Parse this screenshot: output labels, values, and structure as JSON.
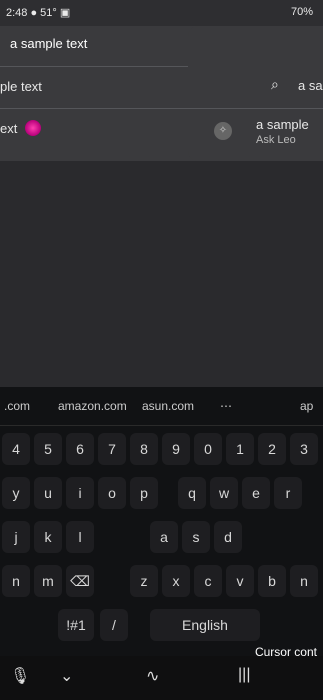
{
  "status": {
    "time": "2:48",
    "icons_left": "● 51° ▣",
    "battery": "70%"
  },
  "search": {
    "value": "a sample text",
    "clear_icon": "✕"
  },
  "results_left": [
    {
      "label": "ple text"
    },
    {
      "label": "ext"
    }
  ],
  "results_right": [
    {
      "icon": "search-icon",
      "label": "a sa"
    },
    {
      "icon": "assistant-icon",
      "label": "a sample",
      "sub": "Ask Leo"
    }
  ],
  "keyboard": {
    "suggestions": [
      ".com",
      "amazon.com",
      "asun.com",
      "⋯",
      "ap"
    ],
    "numbers": [
      "4",
      "5",
      "6",
      "7",
      "8",
      "9",
      "0",
      "1",
      "2",
      "3"
    ],
    "row1": [
      "y",
      "u",
      "i",
      "o",
      "p",
      "q",
      "w",
      "e",
      "r"
    ],
    "row2": [
      "j",
      "k",
      "l",
      "a",
      "s",
      "d"
    ],
    "row3": [
      "n",
      "m",
      "⌫",
      "z",
      "x",
      "c",
      "v",
      "b",
      "n"
    ],
    "row4": [
      "!#1",
      "/",
      "English"
    ],
    "cursor_label": "Cursor cont"
  },
  "colors": {
    "accent": "#ff3db0"
  }
}
